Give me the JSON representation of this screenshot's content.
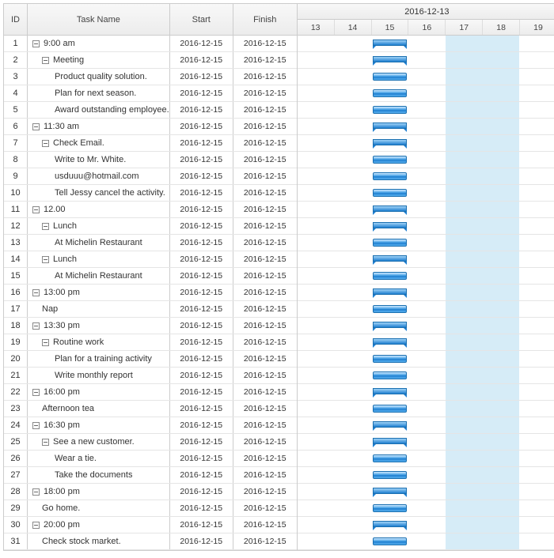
{
  "chart_data": {
    "type": "gantt",
    "title": "2016-12-13",
    "timeline": {
      "days": [
        13,
        14,
        15,
        16,
        17,
        18,
        19
      ],
      "weekend_days": [
        17,
        18
      ]
    },
    "columns": [
      "ID",
      "Task Name",
      "Start",
      "Finish"
    ],
    "tasks": [
      {
        "id": 1,
        "name": "9:00 am",
        "start": "2016-12-15",
        "finish": "2016-12-15",
        "indent": 0,
        "summary": true,
        "bar_day": 15
      },
      {
        "id": 2,
        "name": "Meeting",
        "start": "2016-12-15",
        "finish": "2016-12-15",
        "indent": 1,
        "summary": true,
        "bar_day": 15
      },
      {
        "id": 3,
        "name": "Product quality solution.",
        "start": "2016-12-15",
        "finish": "2016-12-15",
        "indent": 2,
        "summary": false,
        "bar_day": 15
      },
      {
        "id": 4,
        "name": "Plan for next season.",
        "start": "2016-12-15",
        "finish": "2016-12-15",
        "indent": 2,
        "summary": false,
        "bar_day": 15
      },
      {
        "id": 5,
        "name": "Award outstanding employee.",
        "start": "2016-12-15",
        "finish": "2016-12-15",
        "indent": 2,
        "summary": false,
        "bar_day": 15
      },
      {
        "id": 6,
        "name": "11:30 am",
        "start": "2016-12-15",
        "finish": "2016-12-15",
        "indent": 0,
        "summary": true,
        "bar_day": 15
      },
      {
        "id": 7,
        "name": "Check Email.",
        "start": "2016-12-15",
        "finish": "2016-12-15",
        "indent": 1,
        "summary": true,
        "bar_day": 15
      },
      {
        "id": 8,
        "name": "Write to Mr. White.",
        "start": "2016-12-15",
        "finish": "2016-12-15",
        "indent": 2,
        "summary": false,
        "bar_day": 15
      },
      {
        "id": 9,
        "name": "usduuu@hotmail.com",
        "start": "2016-12-15",
        "finish": "2016-12-15",
        "indent": 2,
        "summary": false,
        "bar_day": 15
      },
      {
        "id": 10,
        "name": "Tell Jessy cancel the activity.",
        "start": "2016-12-15",
        "finish": "2016-12-15",
        "indent": 2,
        "summary": false,
        "bar_day": 15
      },
      {
        "id": 11,
        "name": "12.00",
        "start": "2016-12-15",
        "finish": "2016-12-15",
        "indent": 0,
        "summary": true,
        "bar_day": 15
      },
      {
        "id": 12,
        "name": "Lunch",
        "start": "2016-12-15",
        "finish": "2016-12-15",
        "indent": 1,
        "summary": true,
        "bar_day": 15
      },
      {
        "id": 13,
        "name": "At Michelin Restaurant",
        "start": "2016-12-15",
        "finish": "2016-12-15",
        "indent": 2,
        "summary": false,
        "bar_day": 15
      },
      {
        "id": 14,
        "name": "Lunch",
        "start": "2016-12-15",
        "finish": "2016-12-15",
        "indent": 1,
        "summary": true,
        "bar_day": 15
      },
      {
        "id": 15,
        "name": "At Michelin Restaurant",
        "start": "2016-12-15",
        "finish": "2016-12-15",
        "indent": 2,
        "summary": false,
        "bar_day": 15
      },
      {
        "id": 16,
        "name": "13:00 pm",
        "start": "2016-12-15",
        "finish": "2016-12-15",
        "indent": 0,
        "summary": true,
        "bar_day": 15
      },
      {
        "id": 17,
        "name": "Nap",
        "start": "2016-12-15",
        "finish": "2016-12-15",
        "indent": 1,
        "summary": false,
        "bar_day": 15
      },
      {
        "id": 18,
        "name": "13:30 pm",
        "start": "2016-12-15",
        "finish": "2016-12-15",
        "indent": 0,
        "summary": true,
        "bar_day": 15
      },
      {
        "id": 19,
        "name": "Routine work",
        "start": "2016-12-15",
        "finish": "2016-12-15",
        "indent": 1,
        "summary": true,
        "bar_day": 15
      },
      {
        "id": 20,
        "name": "Plan for a training activity",
        "start": "2016-12-15",
        "finish": "2016-12-15",
        "indent": 2,
        "summary": false,
        "bar_day": 15
      },
      {
        "id": 21,
        "name": "Write monthly report",
        "start": "2016-12-15",
        "finish": "2016-12-15",
        "indent": 2,
        "summary": false,
        "bar_day": 15
      },
      {
        "id": 22,
        "name": "16:00 pm",
        "start": "2016-12-15",
        "finish": "2016-12-15",
        "indent": 0,
        "summary": true,
        "bar_day": 15
      },
      {
        "id": 23,
        "name": "Afternoon tea",
        "start": "2016-12-15",
        "finish": "2016-12-15",
        "indent": 1,
        "summary": false,
        "bar_day": 15
      },
      {
        "id": 24,
        "name": "16:30 pm",
        "start": "2016-12-15",
        "finish": "2016-12-15",
        "indent": 0,
        "summary": true,
        "bar_day": 15
      },
      {
        "id": 25,
        "name": "See a new customer.",
        "start": "2016-12-15",
        "finish": "2016-12-15",
        "indent": 1,
        "summary": true,
        "bar_day": 15
      },
      {
        "id": 26,
        "name": "Wear a tie.",
        "start": "2016-12-15",
        "finish": "2016-12-15",
        "indent": 2,
        "summary": false,
        "bar_day": 15
      },
      {
        "id": 27,
        "name": "Take the documents",
        "start": "2016-12-15",
        "finish": "2016-12-15",
        "indent": 2,
        "summary": false,
        "bar_day": 15
      },
      {
        "id": 28,
        "name": "18:00 pm",
        "start": "2016-12-15",
        "finish": "2016-12-15",
        "indent": 0,
        "summary": true,
        "bar_day": 15
      },
      {
        "id": 29,
        "name": "Go home.",
        "start": "2016-12-15",
        "finish": "2016-12-15",
        "indent": 1,
        "summary": false,
        "bar_day": 15
      },
      {
        "id": 30,
        "name": "20:00 pm",
        "start": "2016-12-15",
        "finish": "2016-12-15",
        "indent": 0,
        "summary": true,
        "bar_day": 15
      },
      {
        "id": 31,
        "name": "Check stock market.",
        "start": "2016-12-15",
        "finish": "2016-12-15",
        "indent": 1,
        "summary": false,
        "bar_day": 15
      }
    ]
  },
  "head": {
    "id": "ID",
    "name": "Task Name",
    "start": "Start",
    "finish": "Finish",
    "timeline": "2016-12-13"
  }
}
